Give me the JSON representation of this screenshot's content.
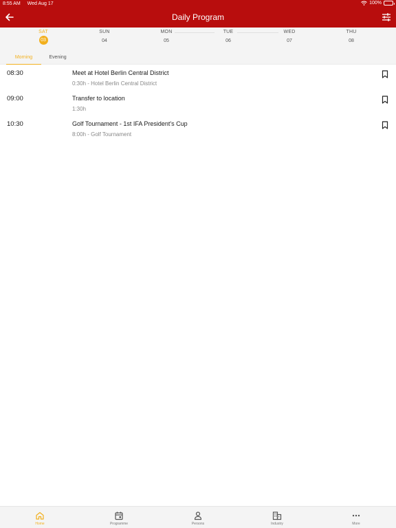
{
  "status_bar": {
    "time": "8:55 AM",
    "date": "Wed Aug 17",
    "battery": "100%"
  },
  "header": {
    "title": "Daily Program"
  },
  "days": [
    {
      "name": "SAT",
      "number": "03",
      "active": true
    },
    {
      "name": "SUN",
      "number": "04",
      "active": false
    },
    {
      "name": "MON",
      "number": "05",
      "active": false
    },
    {
      "name": "TUE",
      "number": "06",
      "active": false
    },
    {
      "name": "WED",
      "number": "07",
      "active": false
    },
    {
      "name": "THU",
      "number": "08",
      "active": false
    }
  ],
  "tabs": [
    {
      "label": "Morning",
      "active": true
    },
    {
      "label": "Evening",
      "active": false
    }
  ],
  "events": [
    {
      "time": "08:30",
      "title": "Meet at Hotel Berlin Central District",
      "subtitle": "0:30h - Hotel Berlin Central District"
    },
    {
      "time": "09:00",
      "title": "Transfer to location",
      "subtitle": "1:30h"
    },
    {
      "time": "10:30",
      "title": "Golf Tournament - 1st IFA President's Cup",
      "subtitle": "8:00h - Golf Tournament"
    }
  ],
  "bottom_nav": [
    {
      "label": "Home",
      "icon": "home-icon",
      "active": true
    },
    {
      "label": "Programme",
      "icon": "calendar-icon",
      "active": false
    },
    {
      "label": "Persons",
      "icon": "person-icon",
      "active": false
    },
    {
      "label": "Industry",
      "icon": "building-icon",
      "active": false
    },
    {
      "label": "More",
      "icon": "more-icon",
      "active": false
    }
  ],
  "colors": {
    "header": "#b80d0d",
    "accent": "#f2b01e",
    "strip": "#f4f4f4"
  }
}
